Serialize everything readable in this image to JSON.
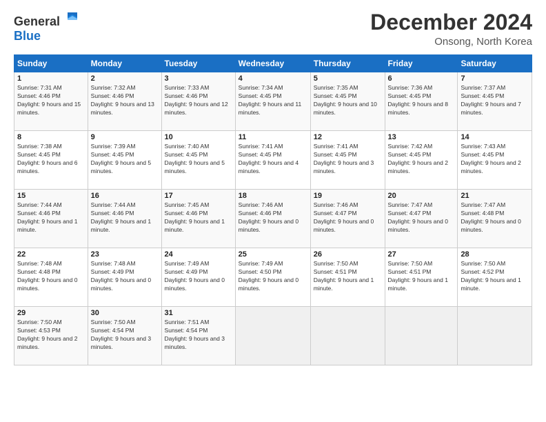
{
  "header": {
    "logo_general": "General",
    "logo_blue": "Blue",
    "month": "December 2024",
    "location": "Onsong, North Korea"
  },
  "weekdays": [
    "Sunday",
    "Monday",
    "Tuesday",
    "Wednesday",
    "Thursday",
    "Friday",
    "Saturday"
  ],
  "weeks": [
    [
      {
        "day": "1",
        "sunrise": "7:31 AM",
        "sunset": "4:46 PM",
        "daylight": "9 hours and 15 minutes."
      },
      {
        "day": "2",
        "sunrise": "7:32 AM",
        "sunset": "4:46 PM",
        "daylight": "9 hours and 13 minutes."
      },
      {
        "day": "3",
        "sunrise": "7:33 AM",
        "sunset": "4:46 PM",
        "daylight": "9 hours and 12 minutes."
      },
      {
        "day": "4",
        "sunrise": "7:34 AM",
        "sunset": "4:45 PM",
        "daylight": "9 hours and 11 minutes."
      },
      {
        "day": "5",
        "sunrise": "7:35 AM",
        "sunset": "4:45 PM",
        "daylight": "9 hours and 10 minutes."
      },
      {
        "day": "6",
        "sunrise": "7:36 AM",
        "sunset": "4:45 PM",
        "daylight": "9 hours and 8 minutes."
      },
      {
        "day": "7",
        "sunrise": "7:37 AM",
        "sunset": "4:45 PM",
        "daylight": "9 hours and 7 minutes."
      }
    ],
    [
      {
        "day": "8",
        "sunrise": "7:38 AM",
        "sunset": "4:45 PM",
        "daylight": "9 hours and 6 minutes."
      },
      {
        "day": "9",
        "sunrise": "7:39 AM",
        "sunset": "4:45 PM",
        "daylight": "9 hours and 5 minutes."
      },
      {
        "day": "10",
        "sunrise": "7:40 AM",
        "sunset": "4:45 PM",
        "daylight": "9 hours and 5 minutes."
      },
      {
        "day": "11",
        "sunrise": "7:41 AM",
        "sunset": "4:45 PM",
        "daylight": "9 hours and 4 minutes."
      },
      {
        "day": "12",
        "sunrise": "7:41 AM",
        "sunset": "4:45 PM",
        "daylight": "9 hours and 3 minutes."
      },
      {
        "day": "13",
        "sunrise": "7:42 AM",
        "sunset": "4:45 PM",
        "daylight": "9 hours and 2 minutes."
      },
      {
        "day": "14",
        "sunrise": "7:43 AM",
        "sunset": "4:45 PM",
        "daylight": "9 hours and 2 minutes."
      }
    ],
    [
      {
        "day": "15",
        "sunrise": "7:44 AM",
        "sunset": "4:46 PM",
        "daylight": "9 hours and 1 minute."
      },
      {
        "day": "16",
        "sunrise": "7:44 AM",
        "sunset": "4:46 PM",
        "daylight": "9 hours and 1 minute."
      },
      {
        "day": "17",
        "sunrise": "7:45 AM",
        "sunset": "4:46 PM",
        "daylight": "9 hours and 1 minute."
      },
      {
        "day": "18",
        "sunrise": "7:46 AM",
        "sunset": "4:46 PM",
        "daylight": "9 hours and 0 minutes."
      },
      {
        "day": "19",
        "sunrise": "7:46 AM",
        "sunset": "4:47 PM",
        "daylight": "9 hours and 0 minutes."
      },
      {
        "day": "20",
        "sunrise": "7:47 AM",
        "sunset": "4:47 PM",
        "daylight": "9 hours and 0 minutes."
      },
      {
        "day": "21",
        "sunrise": "7:47 AM",
        "sunset": "4:48 PM",
        "daylight": "9 hours and 0 minutes."
      }
    ],
    [
      {
        "day": "22",
        "sunrise": "7:48 AM",
        "sunset": "4:48 PM",
        "daylight": "9 hours and 0 minutes."
      },
      {
        "day": "23",
        "sunrise": "7:48 AM",
        "sunset": "4:49 PM",
        "daylight": "9 hours and 0 minutes."
      },
      {
        "day": "24",
        "sunrise": "7:49 AM",
        "sunset": "4:49 PM",
        "daylight": "9 hours and 0 minutes."
      },
      {
        "day": "25",
        "sunrise": "7:49 AM",
        "sunset": "4:50 PM",
        "daylight": "9 hours and 0 minutes."
      },
      {
        "day": "26",
        "sunrise": "7:50 AM",
        "sunset": "4:51 PM",
        "daylight": "9 hours and 1 minute."
      },
      {
        "day": "27",
        "sunrise": "7:50 AM",
        "sunset": "4:51 PM",
        "daylight": "9 hours and 1 minute."
      },
      {
        "day": "28",
        "sunrise": "7:50 AM",
        "sunset": "4:52 PM",
        "daylight": "9 hours and 1 minute."
      }
    ],
    [
      {
        "day": "29",
        "sunrise": "7:50 AM",
        "sunset": "4:53 PM",
        "daylight": "9 hours and 2 minutes."
      },
      {
        "day": "30",
        "sunrise": "7:50 AM",
        "sunset": "4:54 PM",
        "daylight": "9 hours and 3 minutes."
      },
      {
        "day": "31",
        "sunrise": "7:51 AM",
        "sunset": "4:54 PM",
        "daylight": "9 hours and 3 minutes."
      },
      null,
      null,
      null,
      null
    ]
  ]
}
